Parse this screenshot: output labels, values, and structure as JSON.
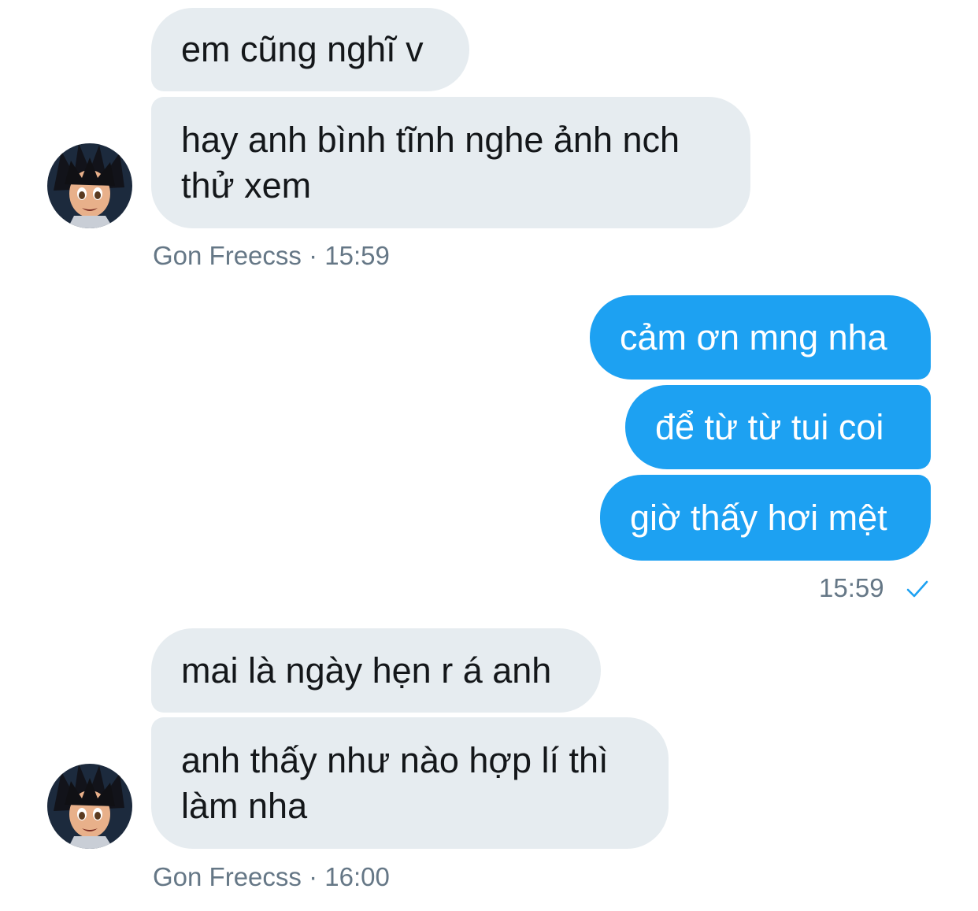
{
  "conversation": {
    "group1": {
      "messages": [
        "em cũng nghĩ v",
        "hay anh bình tĩnh nghe ảnh nch\nthử xem"
      ],
      "sender": "Gon Freecss",
      "separator": "·",
      "time": "15:59"
    },
    "group2": {
      "messages": [
        "cảm ơn mng nha",
        "để từ từ tui coi",
        "giờ thấy hơi mệt"
      ],
      "time": "15:59",
      "status_icon": "check-icon"
    },
    "group3": {
      "messages": [
        "mai là ngày hẹn r á anh",
        "anh thấy như nào hợp lí thì\nlàm nha"
      ],
      "sender": "Gon Freecss",
      "separator": "·",
      "time": "16:00"
    }
  },
  "colors": {
    "incoming_bubble": "#e6ecf0",
    "outgoing_bubble": "#1da1f2",
    "meta_text": "#657786",
    "check": "#1da1f2"
  }
}
